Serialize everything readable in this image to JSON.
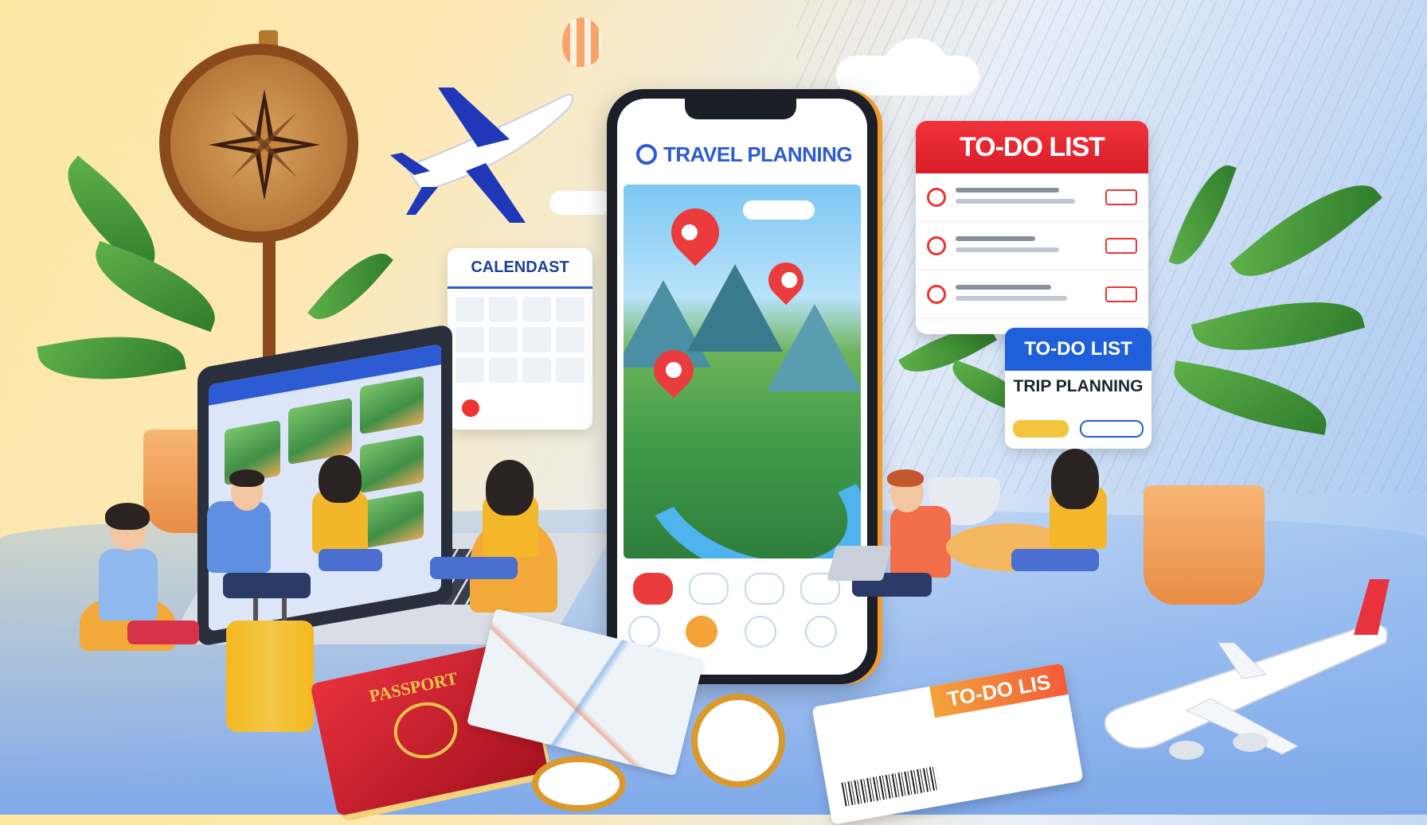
{
  "phone": {
    "title": "TRAVEL PLANNING",
    "nav_row1": [
      "",
      "",
      "",
      ""
    ],
    "nav_row2": [
      "",
      "",
      "",
      ""
    ]
  },
  "calendar": {
    "title": "CALENDAST"
  },
  "todo_card": {
    "title": "TO-DO LIST"
  },
  "trip_card": {
    "title": "TO-DO LIST",
    "subtitle": "TRIP PLANNING"
  },
  "passport": {
    "label": "PASSPORT"
  },
  "boarding_pass": {
    "title": "TO-DO LIS"
  },
  "colors": {
    "brand_blue": "#2c5bd3",
    "todo_red": "#e0232d",
    "accent_orange": "#f29a2e"
  },
  "icons": [
    "compass-icon",
    "airplane-icon",
    "balloon-icon",
    "map-pin-icon",
    "search-icon",
    "calendar-icon",
    "passport-icon",
    "suitcase-icon",
    "laptop-icon",
    "plant-icon"
  ]
}
